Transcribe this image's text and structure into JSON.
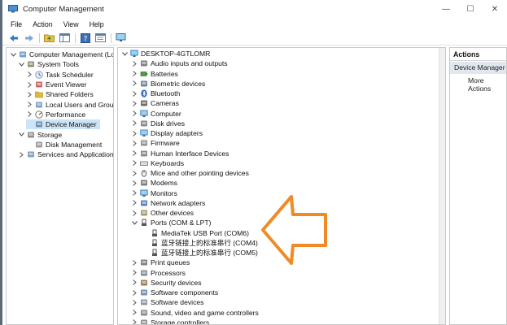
{
  "window": {
    "title": "Computer Management",
    "controls": {
      "minimize": "—",
      "maximize": "☐",
      "close": "✕"
    }
  },
  "menu": [
    "File",
    "Action",
    "View",
    "Help"
  ],
  "left_tree": [
    {
      "label": "Computer Management (Local",
      "indent": 0,
      "expander": "down",
      "icon": "computer-management-icon"
    },
    {
      "label": "System Tools",
      "indent": 1,
      "expander": "down",
      "icon": "tools-icon"
    },
    {
      "label": "Task Scheduler",
      "indent": 2,
      "expander": "right",
      "icon": "clock-icon"
    },
    {
      "label": "Event Viewer",
      "indent": 2,
      "expander": "right",
      "icon": "event-viewer-icon"
    },
    {
      "label": "Shared Folders",
      "indent": 2,
      "expander": "right",
      "icon": "shared-folder-icon"
    },
    {
      "label": "Local Users and Groups",
      "indent": 2,
      "expander": "right",
      "icon": "users-icon"
    },
    {
      "label": "Performance",
      "indent": 2,
      "expander": "right",
      "icon": "performance-icon"
    },
    {
      "label": "Device Manager",
      "indent": 2,
      "expander": "none",
      "icon": "device-manager-icon",
      "selected": true
    },
    {
      "label": "Storage",
      "indent": 1,
      "expander": "down",
      "icon": "storage-icon"
    },
    {
      "label": "Disk Management",
      "indent": 2,
      "expander": "none",
      "icon": "disk-icon"
    },
    {
      "label": "Services and Applications",
      "indent": 1,
      "expander": "right",
      "icon": "services-icon"
    }
  ],
  "device_tree": {
    "root": "DESKTOP-4GTLOMR",
    "categories": [
      {
        "label": "Audio inputs and outputs",
        "icon": "speaker-icon"
      },
      {
        "label": "Batteries",
        "icon": "battery-icon"
      },
      {
        "label": "Biometric devices",
        "icon": "fingerprint-icon"
      },
      {
        "label": "Bluetooth",
        "icon": "bluetooth-icon"
      },
      {
        "label": "Cameras",
        "icon": "camera-icon"
      },
      {
        "label": "Computer",
        "icon": "computer-icon"
      },
      {
        "label": "Disk drives",
        "icon": "disk-drive-icon"
      },
      {
        "label": "Display adapters",
        "icon": "display-icon"
      },
      {
        "label": "Firmware",
        "icon": "chip-icon"
      },
      {
        "label": "Human Interface Devices",
        "icon": "hid-icon"
      },
      {
        "label": "Keyboards",
        "icon": "keyboard-icon"
      },
      {
        "label": "Mice and other pointing devices",
        "icon": "mouse-icon"
      },
      {
        "label": "Modems",
        "icon": "modem-icon"
      },
      {
        "label": "Monitors",
        "icon": "monitor-icon"
      },
      {
        "label": "Network adapters",
        "icon": "network-icon"
      },
      {
        "label": "Other devices",
        "icon": "other-devices-icon"
      },
      {
        "label": "Ports (COM & LPT)",
        "icon": "port-icon",
        "expanded": true,
        "children": [
          "MediaTek USB Port (COM6)",
          "蓝牙链接上的标准串行 (COM4)",
          "蓝牙链接上的标准串行 (COM5)"
        ]
      },
      {
        "label": "Print queues",
        "icon": "printer-icon"
      },
      {
        "label": "Processors",
        "icon": "processor-icon"
      },
      {
        "label": "Security devices",
        "icon": "security-icon"
      },
      {
        "label": "Software components",
        "icon": "software-component-icon"
      },
      {
        "label": "Software devices",
        "icon": "software-device-icon"
      },
      {
        "label": "Sound, video and game controllers",
        "icon": "sound-icon"
      },
      {
        "label": "Storage controllers",
        "icon": "storage-controller-icon"
      }
    ]
  },
  "actions": {
    "header": "Actions",
    "section": "Device Manager",
    "more": "More Actions"
  },
  "colors": {
    "selection": "#cce4f7",
    "annotation_arrow": "#f08a24",
    "actions_band": "#e0e7ee"
  }
}
